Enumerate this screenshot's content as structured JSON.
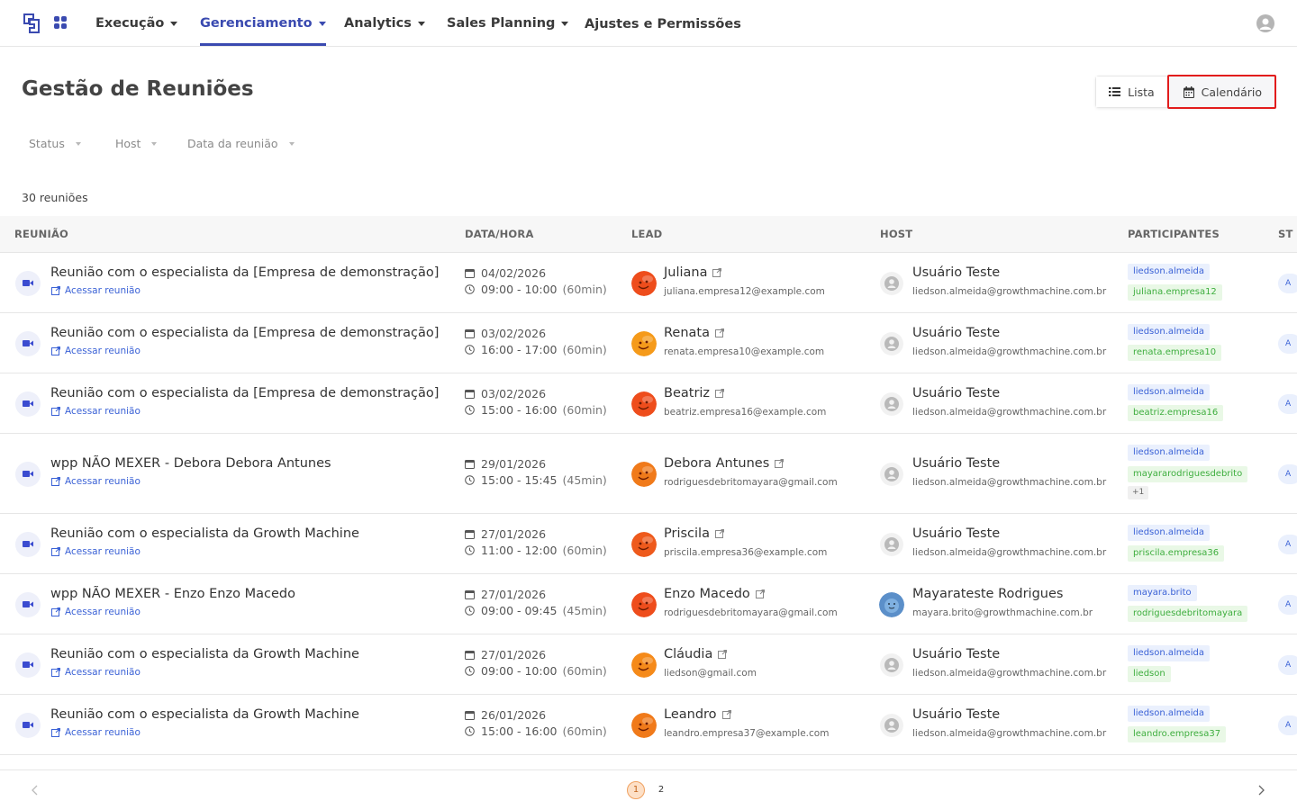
{
  "nav": {
    "items": [
      {
        "label": "Execução",
        "caret": true,
        "active": false
      },
      {
        "label": "Gerenciamento",
        "caret": true,
        "active": true
      },
      {
        "label": "Analytics",
        "caret": true,
        "active": false
      },
      {
        "label": "Sales Planning",
        "caret": true,
        "active": false
      },
      {
        "label": "Ajustes e Permissões",
        "caret": false,
        "active": false
      }
    ],
    "accent_color": "#3a4ab0"
  },
  "page": {
    "title": "Gestão de Reuniões",
    "view_toggle": {
      "list_label": "Lista",
      "calendar_label": "Calendário"
    },
    "filters": [
      "Status",
      "Host",
      "Data da reunião"
    ],
    "count_label": "30 reuniões"
  },
  "table": {
    "headers": [
      "REUNIÃO",
      "DATA/HORA",
      "LEAD",
      "HOST",
      "PARTICIPANTES",
      "STATUS"
    ],
    "status_header_visible": "ST",
    "link_label": "Acessar reunião",
    "rows": [
      {
        "title": "Reunião com o especialista da [Empresa de demonstração]",
        "date": "04/02/2026",
        "time": "09:00 - 10:00",
        "duration": "(60min)",
        "lead_name": "Juliana",
        "lead_email": "juliana.empresa12@example.com",
        "lead_color": "#ee4d1c",
        "host_name": "Usuário Teste",
        "host_email": "liedson.almeida@growthmachine.com.br",
        "host_avatar": "default",
        "tags": [
          {
            "text": "liedson.almeida",
            "kind": "blue"
          },
          {
            "text": "juliana.empresa12",
            "kind": "green"
          }
        ]
      },
      {
        "title": "Reunião com o especialista da [Empresa de demonstração]",
        "date": "03/02/2026",
        "time": "16:00 - 17:00",
        "duration": "(60min)",
        "lead_name": "Renata",
        "lead_email": "renata.empresa10@example.com",
        "lead_color": "#f59a1a",
        "host_name": "Usuário Teste",
        "host_email": "liedson.almeida@growthmachine.com.br",
        "host_avatar": "default",
        "tags": [
          {
            "text": "liedson.almeida",
            "kind": "blue"
          },
          {
            "text": "renata.empresa10",
            "kind": "green"
          }
        ]
      },
      {
        "title": "Reunião com o especialista da [Empresa de demonstração]",
        "date": "03/02/2026",
        "time": "15:00 - 16:00",
        "duration": "(60min)",
        "lead_name": "Beatriz",
        "lead_email": "beatriz.empresa16@example.com",
        "lead_color": "#ee4d1c",
        "host_name": "Usuário Teste",
        "host_email": "liedson.almeida@growthmachine.com.br",
        "host_avatar": "default",
        "tags": [
          {
            "text": "liedson.almeida",
            "kind": "blue"
          },
          {
            "text": "beatriz.empresa16",
            "kind": "green"
          }
        ]
      },
      {
        "title": "wpp NÃO MEXER - Debora Debora Antunes",
        "date": "29/01/2026",
        "time": "15:00 - 15:45",
        "duration": "(45min)",
        "lead_name": "Debora Antunes",
        "lead_email": "rodriguesdebritomayara@gmail.com",
        "lead_color": "#f07a1a",
        "host_name": "Usuário Teste",
        "host_email": "liedson.almeida@growthmachine.com.br",
        "host_avatar": "default",
        "tags": [
          {
            "text": "liedson.almeida",
            "kind": "blue"
          },
          {
            "text": "mayararodriguesdebrito",
            "kind": "green"
          },
          {
            "text": "+1",
            "kind": "grey"
          }
        ]
      },
      {
        "title": "Reunião com o especialista da Growth Machine",
        "date": "27/01/2026",
        "time": "11:00 - 12:00",
        "duration": "(60min)",
        "lead_name": "Priscila",
        "lead_email": "priscila.empresa36@example.com",
        "lead_color": "#ee5a1c",
        "host_name": "Usuário Teste",
        "host_email": "liedson.almeida@growthmachine.com.br",
        "host_avatar": "default",
        "tags": [
          {
            "text": "liedson.almeida",
            "kind": "blue"
          },
          {
            "text": "priscila.empresa36",
            "kind": "green"
          }
        ]
      },
      {
        "title": "wpp NÃO MEXER - Enzo Enzo Macedo",
        "date": "27/01/2026",
        "time": "09:00 - 09:45",
        "duration": "(45min)",
        "lead_name": "Enzo Macedo",
        "lead_email": "rodriguesdebritomayara@gmail.com",
        "lead_color": "#ee4d1c",
        "host_name": "Mayarateste Rodrigues",
        "host_email": "mayara.brito@growthmachine.com.br",
        "host_avatar": "blue",
        "tags": [
          {
            "text": "mayara.brito",
            "kind": "blue"
          },
          {
            "text": "rodriguesdebritomayara",
            "kind": "green"
          }
        ]
      },
      {
        "title": "Reunião com o especialista da Growth Machine",
        "date": "27/01/2026",
        "time": "09:00 - 10:00",
        "duration": "(60min)",
        "lead_name": "Cláudia",
        "lead_email": "liedson@gmail.com",
        "lead_color": "#f58a1a",
        "host_name": "Usuário Teste",
        "host_email": "liedson.almeida@growthmachine.com.br",
        "host_avatar": "default",
        "tags": [
          {
            "text": "liedson.almeida",
            "kind": "blue"
          },
          {
            "text": "liedson",
            "kind": "green"
          }
        ]
      },
      {
        "title": "Reunião com o especialista da Growth Machine",
        "date": "26/01/2026",
        "time": "15:00 - 16:00",
        "duration": "(60min)",
        "lead_name": "Leandro",
        "lead_email": "leandro.empresa37@example.com",
        "lead_color": "#f07a1a",
        "host_name": "Usuário Teste",
        "host_email": "liedson.almeida@growthmachine.com.br",
        "host_avatar": "default",
        "tags": [
          {
            "text": "liedson.almeida",
            "kind": "blue"
          },
          {
            "text": "leandro.empresa37",
            "kind": "green"
          }
        ]
      }
    ]
  },
  "pagination": {
    "pages": [
      "1",
      "2"
    ],
    "current": "1"
  },
  "icons": {
    "logo": "logo-icon",
    "apps": "apps-grid-icon",
    "user": "user-avatar-icon",
    "list": "list-icon",
    "calendar": "calendar-icon",
    "camera": "video-camera-icon",
    "external": "external-link-icon",
    "clock": "clock-icon"
  }
}
